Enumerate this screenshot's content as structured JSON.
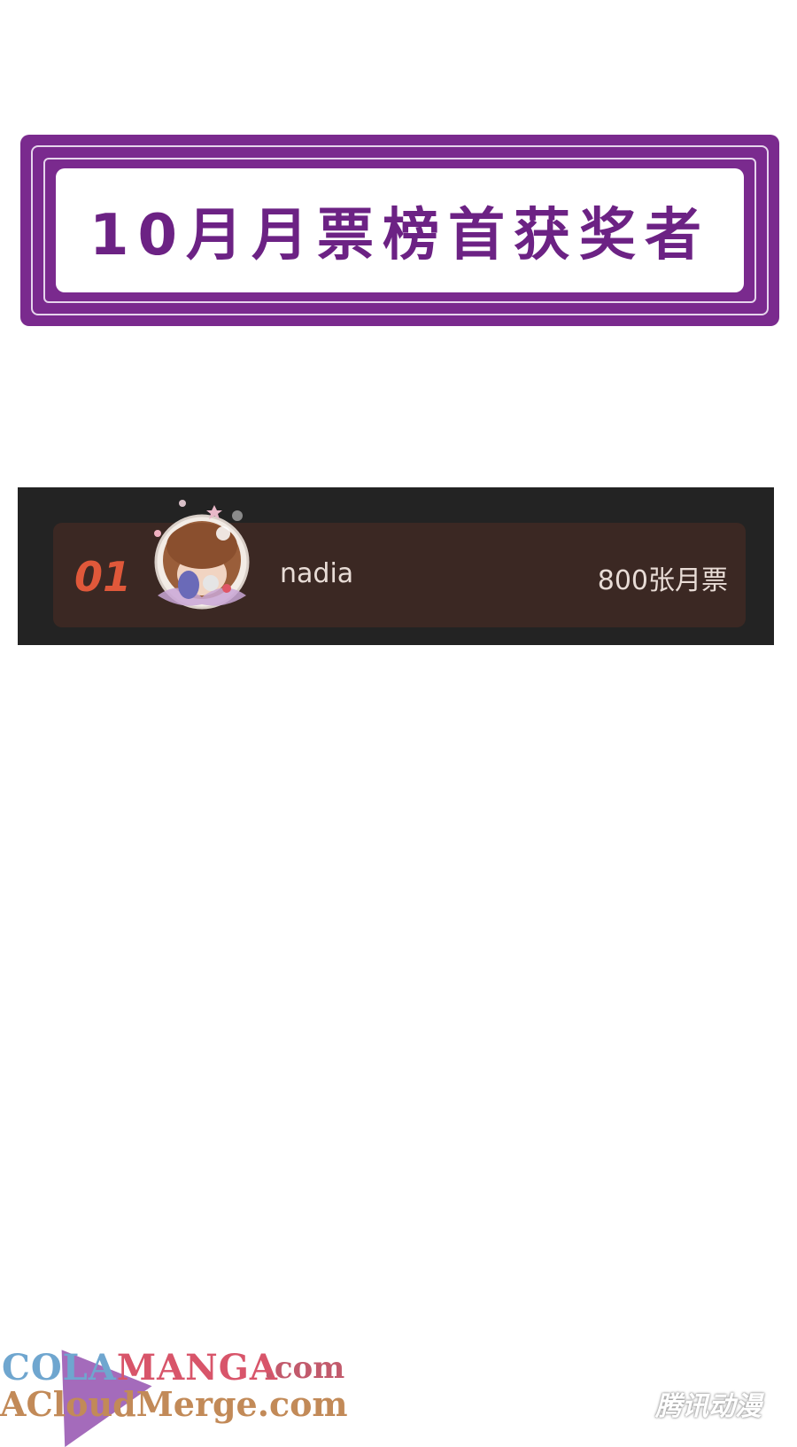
{
  "title_banner": {
    "text": "10月月票榜首获奖者"
  },
  "ranking": {
    "rows": [
      {
        "rank": "01",
        "name": "nadia",
        "votes": "800张月票"
      }
    ]
  },
  "watermarks": {
    "line1_lead": "COLA",
    "line1_rest": "MANGA",
    "line1_suffix": ".com",
    "line2": "ACloudMerge.com",
    "logo": "腾讯动漫"
  },
  "colors": {
    "banner": "#7a2a8e",
    "title_text": "#6c2284",
    "panel": "#232323",
    "row": "#3b2823",
    "rank": "#e0583a"
  }
}
